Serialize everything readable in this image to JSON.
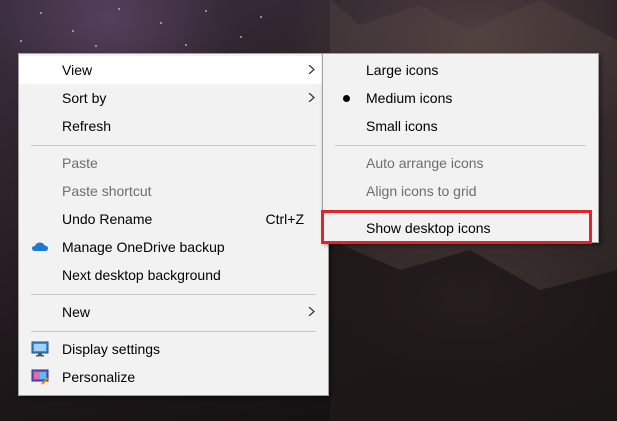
{
  "context_menu": {
    "items": [
      {
        "label": "View"
      },
      {
        "label": "Sort by"
      },
      {
        "label": "Refresh"
      },
      {
        "label": "Paste"
      },
      {
        "label": "Paste shortcut"
      },
      {
        "label": "Undo Rename",
        "shortcut": "Ctrl+Z"
      },
      {
        "label": "Manage OneDrive backup"
      },
      {
        "label": "Next desktop background"
      },
      {
        "label": "New"
      },
      {
        "label": "Display settings"
      },
      {
        "label": "Personalize"
      }
    ]
  },
  "view_submenu": {
    "items": [
      {
        "label": "Large icons"
      },
      {
        "label": "Medium icons"
      },
      {
        "label": "Small icons"
      },
      {
        "label": "Auto arrange icons"
      },
      {
        "label": "Align icons to grid"
      },
      {
        "label": "Show desktop icons"
      }
    ]
  },
  "colors": {
    "menu_background": "#f2f2f2",
    "disabled_text": "#6d6d6d",
    "highlight_outline": "#e3222b",
    "onedrive_blue": "#1f7ad6"
  }
}
